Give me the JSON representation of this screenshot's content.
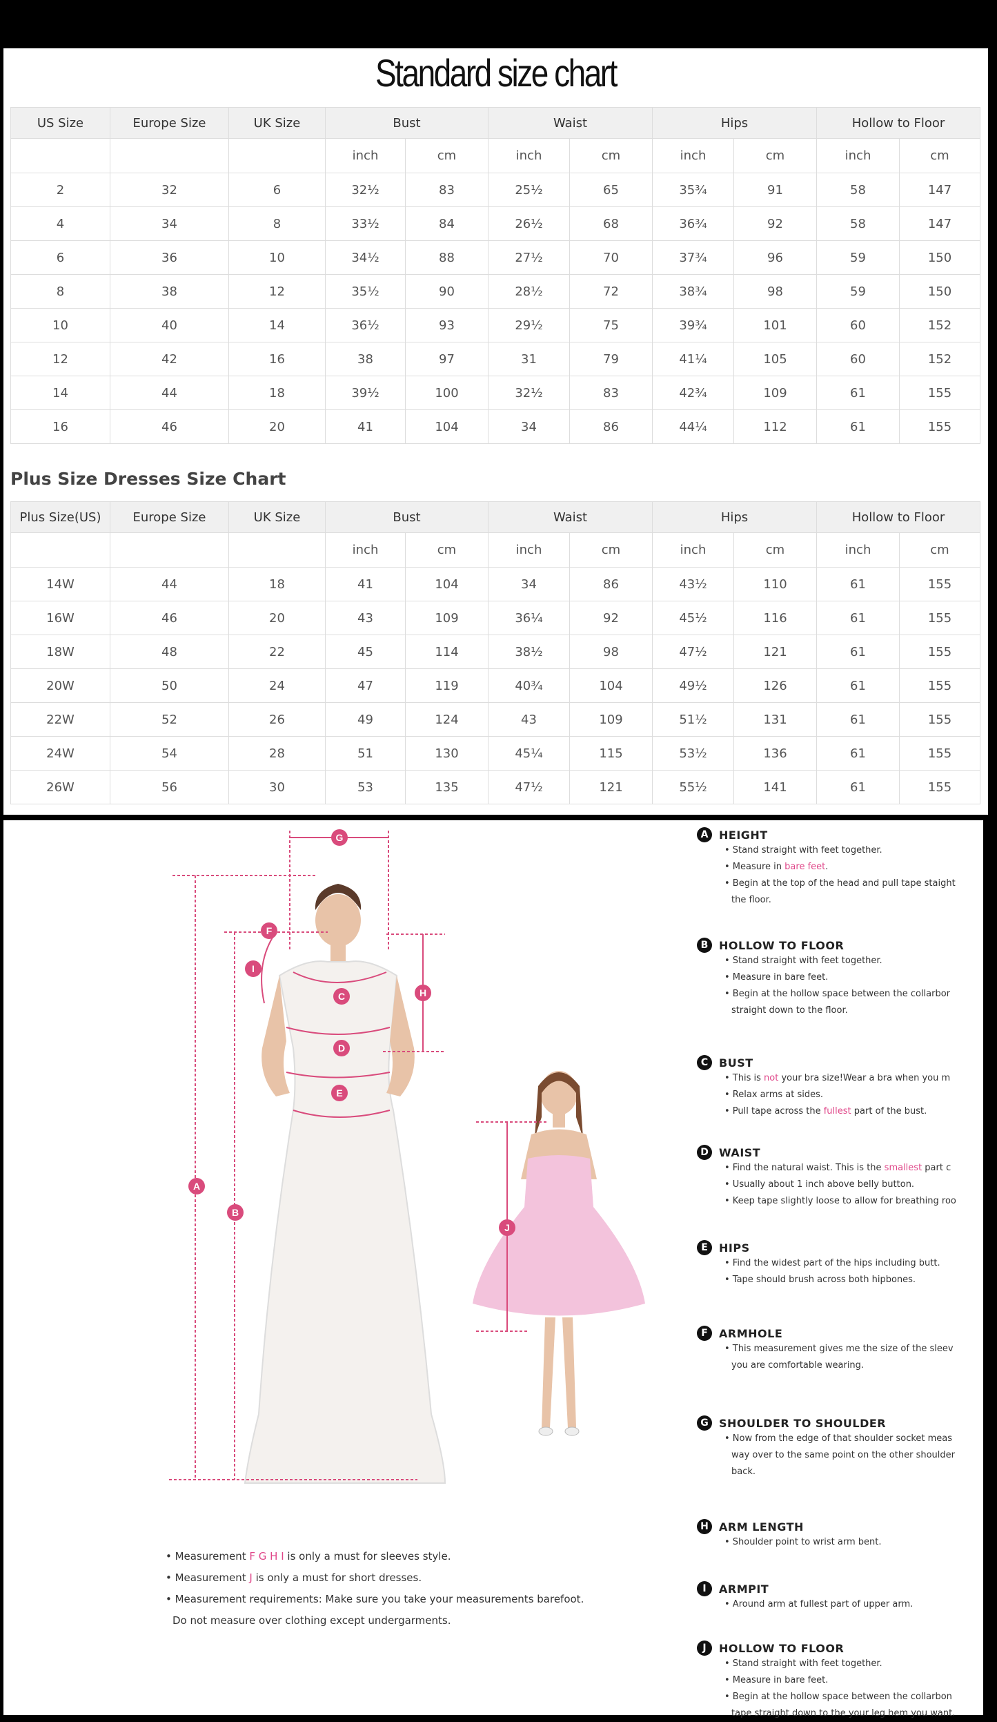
{
  "title": "Standard size chart",
  "standard": {
    "headers": [
      "US Size",
      "Europe Size",
      "UK Size",
      "Bust",
      "Waist",
      "Hips",
      "Hollow to Floor"
    ],
    "units": [
      "inch",
      "cm",
      "inch",
      "cm",
      "inch",
      "cm",
      "inch",
      "cm"
    ],
    "rows": [
      [
        "2",
        "32",
        "6",
        "32½",
        "83",
        "25½",
        "65",
        "35¾",
        "91",
        "58",
        "147"
      ],
      [
        "4",
        "34",
        "8",
        "33½",
        "84",
        "26½",
        "68",
        "36¾",
        "92",
        "58",
        "147"
      ],
      [
        "6",
        "36",
        "10",
        "34½",
        "88",
        "27½",
        "70",
        "37¾",
        "96",
        "59",
        "150"
      ],
      [
        "8",
        "38",
        "12",
        "35½",
        "90",
        "28½",
        "72",
        "38¾",
        "98",
        "59",
        "150"
      ],
      [
        "10",
        "40",
        "14",
        "36½",
        "93",
        "29½",
        "75",
        "39¾",
        "101",
        "60",
        "152"
      ],
      [
        "12",
        "42",
        "16",
        "38",
        "97",
        "31",
        "79",
        "41¼",
        "105",
        "60",
        "152"
      ],
      [
        "14",
        "44",
        "18",
        "39½",
        "100",
        "32½",
        "83",
        "42¾",
        "109",
        "61",
        "155"
      ],
      [
        "16",
        "46",
        "20",
        "41",
        "104",
        "34",
        "86",
        "44¼",
        "112",
        "61",
        "155"
      ]
    ]
  },
  "plus": {
    "heading": "Plus Size Dresses Size Chart",
    "headers": [
      "Plus Size(US)",
      "Europe Size",
      "UK Size",
      "Bust",
      "Waist",
      "Hips",
      "Hollow to Floor"
    ],
    "units": [
      "inch",
      "cm",
      "inch",
      "cm",
      "inch",
      "cm",
      "inch",
      "cm"
    ],
    "rows": [
      [
        "14W",
        "44",
        "18",
        "41",
        "104",
        "34",
        "86",
        "43½",
        "110",
        "61",
        "155"
      ],
      [
        "16W",
        "46",
        "20",
        "43",
        "109",
        "36¼",
        "92",
        "45½",
        "116",
        "61",
        "155"
      ],
      [
        "18W",
        "48",
        "22",
        "45",
        "114",
        "38½",
        "98",
        "47½",
        "121",
        "61",
        "155"
      ],
      [
        "20W",
        "50",
        "24",
        "47",
        "119",
        "40¾",
        "104",
        "49½",
        "126",
        "61",
        "155"
      ],
      [
        "22W",
        "52",
        "26",
        "49",
        "124",
        "43",
        "109",
        "51½",
        "131",
        "61",
        "155"
      ],
      [
        "24W",
        "54",
        "28",
        "51",
        "130",
        "45¼",
        "115",
        "53½",
        "136",
        "61",
        "155"
      ],
      [
        "26W",
        "56",
        "30",
        "53",
        "135",
        "47½",
        "121",
        "55½",
        "141",
        "61",
        "155"
      ]
    ]
  },
  "figure_markers": [
    "A",
    "B",
    "C",
    "D",
    "E",
    "F",
    "G",
    "H",
    "I",
    "J"
  ],
  "notes": [
    {
      "pre": "• Measurement ",
      "hl": "F G H I",
      "post": " is only a must for sleeves style."
    },
    {
      "pre": "• Measurement ",
      "hl": "J",
      "post": " is only a must for short dresses."
    },
    {
      "pre": "• Measurement requirements: Make sure you take your measurements barefoot.",
      "hl": "",
      "post": ""
    },
    {
      "pre": "Do not measure over clothing except undergarments.",
      "hl": "",
      "post": ""
    }
  ],
  "steps": [
    {
      "letter": "A",
      "title": "HEIGHT",
      "lines": [
        {
          "pre": "• Stand straight with feet together.",
          "hl": "",
          "post": ""
        },
        {
          "pre": "• Measure in ",
          "hl": "bare feet",
          "post": "."
        },
        {
          "pre": "• Begin at the top of the head and pull tape staight",
          "hl": "",
          "post": ""
        },
        {
          "pre": "the floor.",
          "hl": "",
          "post": ""
        }
      ]
    },
    {
      "letter": "B",
      "title": "HOLLOW TO FLOOR",
      "lines": [
        {
          "pre": "• Stand straight with feet together.",
          "hl": "",
          "post": ""
        },
        {
          "pre": "• Measure in bare feet.",
          "hl": "",
          "post": ""
        },
        {
          "pre": "• Begin at the hollow space between  the collarbor",
          "hl": "",
          "post": ""
        },
        {
          "pre": "straight down to the floor.",
          "hl": "",
          "post": ""
        }
      ]
    },
    {
      "letter": "C",
      "title": "BUST",
      "lines": [
        {
          "pre": "• This is ",
          "hl": "not",
          "post": " your bra size!Wear a bra when you m"
        },
        {
          "pre": "• Relax arms at sides.",
          "hl": "",
          "post": ""
        },
        {
          "pre": "• Pull tape across the ",
          "hl": "fullest",
          "post": " part of the bust."
        }
      ]
    },
    {
      "letter": "D",
      "title": "WAIST",
      "lines": [
        {
          "pre": "• Find the natural waist. This is the ",
          "hl": "smallest",
          "post": " part c"
        },
        {
          "pre": "• Usually about 1 inch above belly button.",
          "hl": "",
          "post": ""
        },
        {
          "pre": "• Keep tape slightly loose to allow for breathing roo",
          "hl": "",
          "post": ""
        }
      ]
    },
    {
      "letter": "E",
      "title": "HIPS",
      "lines": [
        {
          "pre": "• Find the widest part of the hips including butt.",
          "hl": "",
          "post": ""
        },
        {
          "pre": "• Tape should brush across both hipbones.",
          "hl": "",
          "post": ""
        }
      ]
    },
    {
      "letter": "F",
      "title": "ARMHOLE",
      "lines": [
        {
          "pre": "• This measurement gives me the size of the sleev",
          "hl": "",
          "post": ""
        },
        {
          "pre": "you are comfortable wearing.",
          "hl": "",
          "post": ""
        }
      ]
    },
    {
      "letter": "G",
      "title": "SHOULDER TO SHOULDER",
      "lines": [
        {
          "pre": "• Now from the edge of that shoulder socket meas",
          "hl": "",
          "post": ""
        },
        {
          "pre": "way over to the same point on the other shoulder",
          "hl": "",
          "post": ""
        },
        {
          "pre": "back.",
          "hl": "",
          "post": ""
        }
      ]
    },
    {
      "letter": "H",
      "title": "ARM LENGTH",
      "lines": [
        {
          "pre": "• Shoulder point to wrist arm bent.",
          "hl": "",
          "post": ""
        }
      ]
    },
    {
      "letter": "I",
      "title": "ARMPIT",
      "lines": [
        {
          "pre": "• Around arm at fullest part of upper arm.",
          "hl": "",
          "post": ""
        }
      ]
    },
    {
      "letter": "J",
      "title": "HOLLOW TO FLOOR",
      "lines": [
        {
          "pre": "• Stand straight with feet together.",
          "hl": "",
          "post": ""
        },
        {
          "pre": "• Measure in bare feet.",
          "hl": "",
          "post": ""
        },
        {
          "pre": "• Begin at the hollow space between the collarbon",
          "hl": "",
          "post": ""
        },
        {
          "pre": "tape straight down to the your leg hem you want.",
          "hl": "",
          "post": ""
        }
      ]
    }
  ],
  "colors": {
    "accent": "#e0488a",
    "marker": "#d94b7c",
    "panel": "#ffffff",
    "frame": "#000000"
  }
}
